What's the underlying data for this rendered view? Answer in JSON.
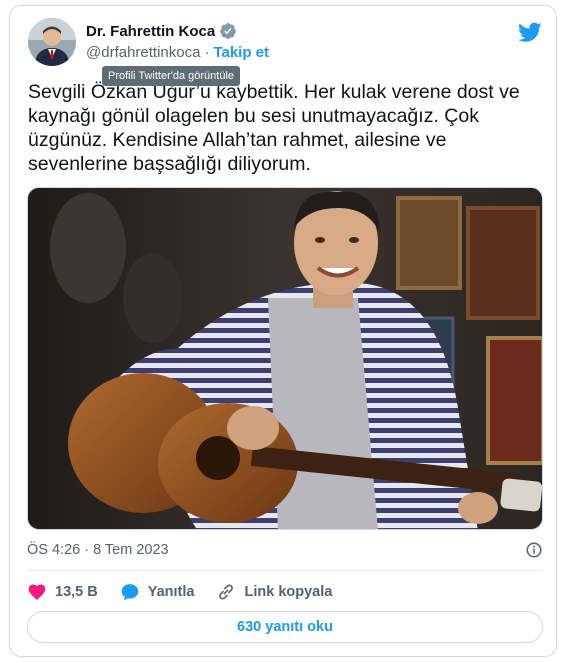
{
  "author": {
    "name": "Dr. Fahrettin Koca",
    "handle": "@drfahrettinkoca",
    "separator": "·",
    "follow_label": "Takip et"
  },
  "tooltip": "Profili Twitter'da görüntüle",
  "tweet": {
    "text": "Sevgili Özkan Uğur’u kaybettik. Her kulak verene dost ve kaynağı gönül olagelen bu sesi unutmayacağız. Çok üzgünüz. Kendisine Allah’tan rahmet, ailesine ve sevenlerine başsağlığı diliyorum.",
    "timestamp": "ÖS 4:26 · 8 Tem 2023"
  },
  "actions": {
    "like_count": "13,5 B",
    "reply_label": "Yanıtla",
    "copy_link_label": "Link kopyala"
  },
  "read_replies_label": "630 yanıtı oku",
  "colors": {
    "accent": "#1d9bf0",
    "like": "#f91880",
    "text": "#0f1419",
    "secondary": "#536471",
    "border": "#cfd9de"
  },
  "icons": [
    "verified-badge-icon",
    "twitter-bird-icon",
    "info-icon",
    "heart-icon",
    "reply-bubble-icon",
    "link-icon"
  ]
}
